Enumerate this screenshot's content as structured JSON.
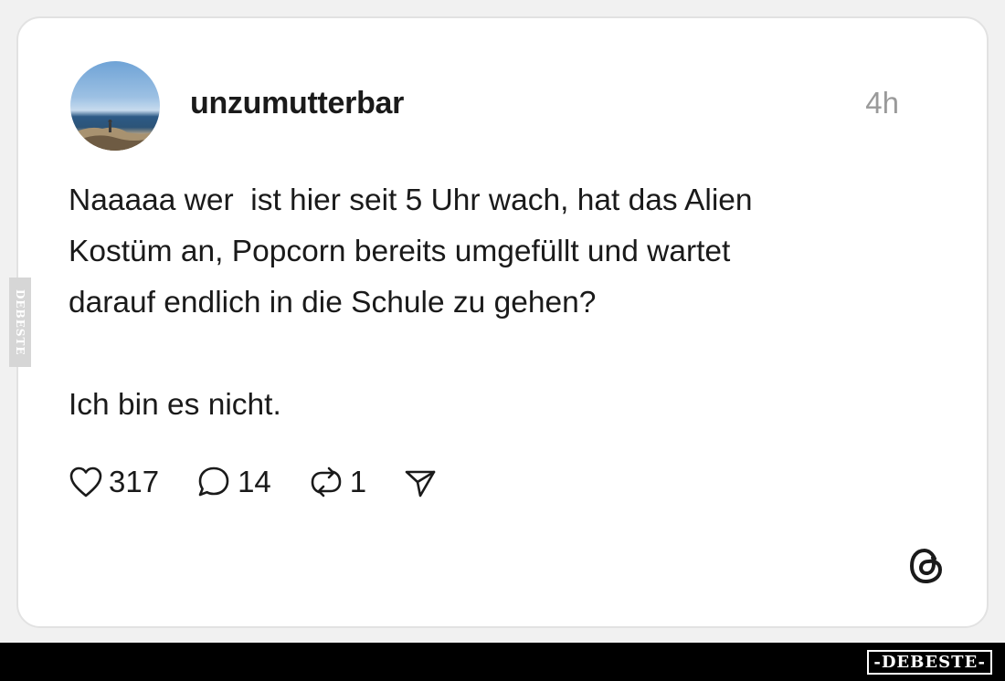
{
  "post": {
    "username": "unzumutterbar",
    "timestamp": "4h",
    "text": "Naaaaa wer  ist hier seit 5 Uhr wach, hat das Alien\nKostüm an, Popcorn bereits umgefüllt und wartet\ndarauf endlich in die Schule zu gehen?\n\nIch bin es nicht.",
    "likes": "317",
    "replies": "14",
    "reposts": "1",
    "avatar_icon": "landscape-photo",
    "platform_icon": "threads-logo-icon"
  },
  "watermark": {
    "side_text": "DEBESTE",
    "brand_text": "-DEBESTE-"
  },
  "colors": {
    "background": "#f1f1f1",
    "card": "#ffffff",
    "text": "#1a1a1a",
    "muted": "#9a9a9a",
    "bar": "#000000"
  }
}
